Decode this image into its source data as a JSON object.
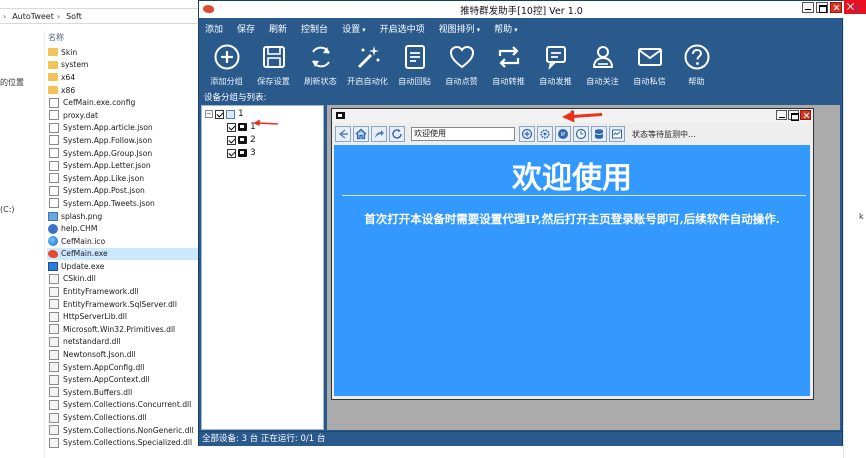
{
  "explorer": {
    "breadcrumb": [
      "AutoTweet",
      "Soft"
    ],
    "nav_items": [
      "的位置",
      "(C:)"
    ],
    "column_name": "名称",
    "files": [
      {
        "name": "Skin",
        "type": "folder"
      },
      {
        "name": "system",
        "type": "folder"
      },
      {
        "name": "x64",
        "type": "folder"
      },
      {
        "name": "x86",
        "type": "folder"
      },
      {
        "name": "CefMain.exe.config",
        "type": "doc"
      },
      {
        "name": "proxy.dat",
        "type": "doc"
      },
      {
        "name": "System.App.article.json",
        "type": "doc"
      },
      {
        "name": "System.App.Follow.json",
        "type": "doc"
      },
      {
        "name": "System.App.Group.Json",
        "type": "doc"
      },
      {
        "name": "System.App.Letter.json",
        "type": "doc"
      },
      {
        "name": "System.App.Like.json",
        "type": "doc"
      },
      {
        "name": "System.App.Post.json",
        "type": "doc"
      },
      {
        "name": "System.App.Tweets.json",
        "type": "doc"
      },
      {
        "name": "splash.png",
        "type": "png"
      },
      {
        "name": "help.CHM",
        "type": "help"
      },
      {
        "name": "CefMain.ico",
        "type": "globe"
      },
      {
        "name": "CefMain.exe",
        "type": "bird",
        "selected": true
      },
      {
        "name": "Update.exe",
        "type": "exe"
      },
      {
        "name": "CSkin.dll",
        "type": "dll"
      },
      {
        "name": "EntityFramework.dll",
        "type": "dll"
      },
      {
        "name": "EntityFramework.SqlServer.dll",
        "type": "dll"
      },
      {
        "name": "HttpServerLib.dll",
        "type": "dll"
      },
      {
        "name": "Microsoft.Win32.Primitives.dll",
        "type": "dll"
      },
      {
        "name": "netstandard.dll",
        "type": "dll"
      },
      {
        "name": "Newtonsoft.Json.dll",
        "type": "dll"
      },
      {
        "name": "System.AppConfig.dll",
        "type": "dll"
      },
      {
        "name": "System.AppContext.dll",
        "type": "dll"
      },
      {
        "name": "System.Buffers.dll",
        "type": "dll"
      },
      {
        "name": "System.Collections.Concurrent.dll",
        "type": "dll"
      },
      {
        "name": "System.Collections.dll",
        "type": "dll"
      },
      {
        "name": "System.Collections.NonGeneric.dll",
        "type": "dll"
      },
      {
        "name": "System.Collections.Specialized.dll",
        "type": "dll"
      }
    ],
    "edge_text": "k"
  },
  "app": {
    "title": "推特群发助手[10控] Ver 1.0",
    "menu": [
      {
        "label": "添加",
        "caret": false
      },
      {
        "label": "保存",
        "caret": false
      },
      {
        "label": "刷新",
        "caret": false
      },
      {
        "label": "控制台",
        "caret": false
      },
      {
        "label": "设置",
        "caret": true
      },
      {
        "label": "开启选中项",
        "caret": false
      },
      {
        "label": "视图排列",
        "caret": true
      },
      {
        "label": "帮助",
        "caret": true
      }
    ],
    "toolbar": [
      {
        "label": "添加分组",
        "icon": "add-circle-icon"
      },
      {
        "label": "保存设置",
        "icon": "save-icon"
      },
      {
        "label": "刷新状态",
        "icon": "refresh-icon"
      },
      {
        "label": "开启自动化",
        "icon": "magic-wand-icon"
      },
      {
        "label": "自动回贴",
        "icon": "document-icon"
      },
      {
        "label": "自动点赞",
        "icon": "heart-icon"
      },
      {
        "label": "自动转推",
        "icon": "retweet-icon"
      },
      {
        "label": "自动发推",
        "icon": "post-icon"
      },
      {
        "label": "自动关注",
        "icon": "user-follow-icon"
      },
      {
        "label": "自动私信",
        "icon": "mail-icon"
      },
      {
        "label": "帮助",
        "icon": "help-icon"
      }
    ],
    "group_list_label": "设备分组与列表:",
    "tree": {
      "group": {
        "label": "1",
        "checked": true
      },
      "devices": [
        {
          "label": "1",
          "checked": true
        },
        {
          "label": "2",
          "checked": true
        },
        {
          "label": "3",
          "checked": true
        }
      ]
    },
    "device_window": {
      "title": "1",
      "url": "欢迎使用",
      "status": "状态等待监测中...",
      "welcome": "欢迎使用",
      "description": "首次打开本设备时需要设置代理IP,然后打开主页登录账号即可,后续软件自动操作."
    },
    "statusbar": "全部设备: 3 台  正在运行: 0/1 台"
  },
  "colors": {
    "app_bg": "#2a5a8c",
    "webview_bg": "#3399ff",
    "annotation_arrow": "#e8321c",
    "selection": "#cce8ff"
  }
}
